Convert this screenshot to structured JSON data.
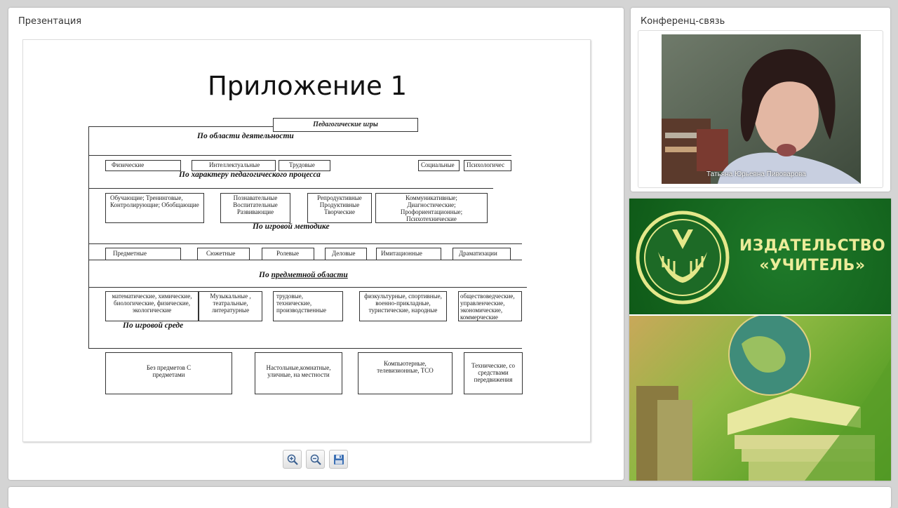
{
  "presentation": {
    "title": "Презентация",
    "slide": {
      "heading": "Приложение 1",
      "root_box": "Педагогические игры",
      "section1": "По области деятельности",
      "row1": [
        "Физические",
        "Интеллектуальные",
        "Трудовые",
        "Социальные",
        "Психологичес"
      ],
      "section2": "По характеру педагогического процесса",
      "row2": [
        "Обучающие; Тренинговые, Контролирующие; Обобщающие",
        "Познавательные Воспитательные Развивающие",
        "Репродуктивные Продуктивные Творческие",
        "Коммуникативные; Диагностические; Профориентационные; Психотехнические"
      ],
      "section3": "По игровой методике",
      "row3": [
        "Предметные",
        "Сюжетные",
        "Ролевые",
        "Деловые",
        "Имитационные",
        "Драматизации"
      ],
      "section4_prefix": "По ",
      "section4_underlined": "предметной области",
      "row4": [
        "математические, химические, биологические, физические, экологические",
        "Музыкальные , театральные, литературные",
        "трудовые, технические, производственные",
        "физкультурные, спортивные, военно-прикладные, туристические, народные",
        "обществоведческие, управленческие, экономические, коммерческие"
      ],
      "section5": "По игровой среде",
      "row5": [
        "Без предметов С предметами",
        "Настольные,комнатные, уличные, на местности",
        "Компьютерные, телевизионные, ТСО",
        "Технические, со средствами передвижения"
      ]
    },
    "toolbar": {
      "zoom_in_icon": "zoom-in-icon",
      "zoom_out_icon": "zoom-out-icon",
      "save_icon": "save-icon"
    }
  },
  "conference": {
    "title": "Конференц-связь",
    "participant_name": "Татьяна Юрьевна Пивоварова"
  },
  "banner": {
    "line1": "ИЗДАТЕЛЬСТВО",
    "line2": "«УЧИТЕЛЬ»",
    "colors": {
      "green": "#1b6e25",
      "text": "#ecec9a"
    }
  }
}
